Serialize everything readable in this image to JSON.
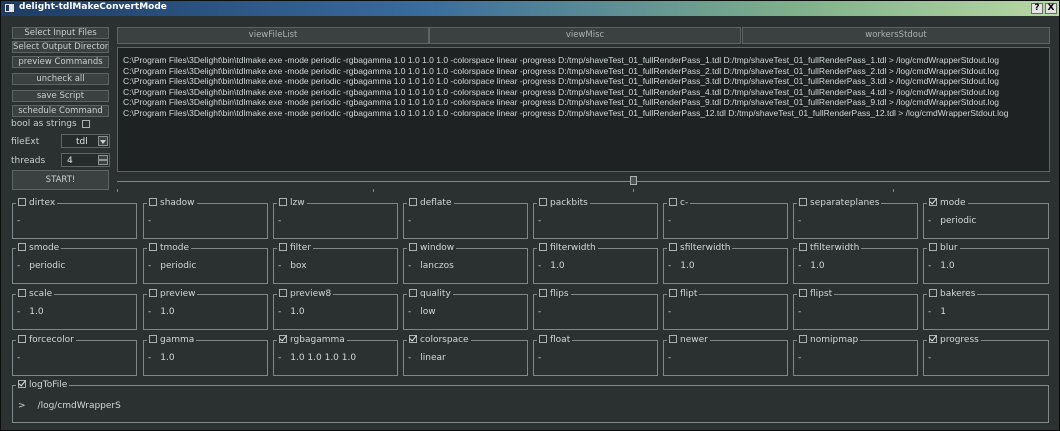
{
  "window": {
    "title": "delight-tdlMakeConvertMode",
    "help_glyph": "?",
    "close_glyph": "X"
  },
  "left_panel": {
    "buttons": [
      "Select Input Files",
      "Select Output Directory",
      "preview Commands",
      "uncheck all",
      "save Script",
      "schedule Command"
    ],
    "bool_as_strings_label": "bool as strings",
    "file_ext_label": "fileExt",
    "file_ext_value": "tdl",
    "threads_label": "threads",
    "threads_value": "4",
    "start_label": "START!"
  },
  "tabs": [
    "viewFileList",
    "viewMisc",
    "workersStdout"
  ],
  "log_lines": [
    "C:\\Program Files\\3Delight\\bin\\tdlmake.exe -mode periodic -rgbagamma 1.0 1.0 1.0 1.0 -colorspace linear -progress D:/tmp/shaveTest_01_fullRenderPass_1.tdl D:/tmp/shaveTest_01_fullRenderPass_1.tdl > /log/cmdWrapperStdout.log",
    "C:\\Program Files\\3Delight\\bin\\tdlmake.exe -mode periodic -rgbagamma 1.0 1.0 1.0 1.0 -colorspace linear -progress D:/tmp/shaveTest_01_fullRenderPass_2.tdl D:/tmp/shaveTest_01_fullRenderPass_2.tdl > /log/cmdWrapperStdout.log",
    "C:\\Program Files\\3Delight\\bin\\tdlmake.exe -mode periodic -rgbagamma 1.0 1.0 1.0 1.0 -colorspace linear -progress D:/tmp/shaveTest_01_fullRenderPass_3.tdl D:/tmp/shaveTest_01_fullRenderPass_3.tdl > /log/cmdWrapperStdout.log",
    "C:\\Program Files\\3Delight\\bin\\tdlmake.exe -mode periodic -rgbagamma 1.0 1.0 1.0 1.0 -colorspace linear -progress D:/tmp/shaveTest_01_fullRenderPass_4.tdl D:/tmp/shaveTest_01_fullRenderPass_4.tdl > /log/cmdWrapperStdout.log",
    "C:\\Program Files\\3Delight\\bin\\tdlmake.exe -mode periodic -rgbagamma 1.0 1.0 1.0 1.0 -colorspace linear -progress D:/tmp/shaveTest_01_fullRenderPass_9.tdl D:/tmp/shaveTest_01_fullRenderPass_9.tdl > /log/cmdWrapperStdout.log",
    "C:\\Program Files\\3Delight\\bin\\tdlmake.exe -mode periodic -rgbagamma 1.0 1.0 1.0 1.0 -colorspace linear -progress D:/tmp/shaveTest_01_fullRenderPass_12.tdl D:/tmp/shaveTest_01_fullRenderPass_12.tdl > /log/cmdWrapperStdout.log"
  ],
  "options": [
    {
      "name": "dirtex",
      "checked": false,
      "prefix": "-",
      "value": ""
    },
    {
      "name": "shadow",
      "checked": false,
      "prefix": "-",
      "value": ""
    },
    {
      "name": "lzw",
      "checked": false,
      "prefix": "-",
      "value": ""
    },
    {
      "name": "deflate",
      "checked": false,
      "prefix": "-",
      "value": ""
    },
    {
      "name": "packbits",
      "checked": false,
      "prefix": "-",
      "value": ""
    },
    {
      "name": "c-",
      "checked": false,
      "prefix": "-",
      "value": ""
    },
    {
      "name": "separateplanes",
      "checked": false,
      "prefix": "-",
      "value": ""
    },
    {
      "name": "mode",
      "checked": true,
      "prefix": "-",
      "value": "periodic"
    },
    {
      "name": "smode",
      "checked": false,
      "prefix": "-",
      "value": "periodic"
    },
    {
      "name": "tmode",
      "checked": false,
      "prefix": "-",
      "value": "periodic"
    },
    {
      "name": "filter",
      "checked": false,
      "prefix": "-",
      "value": "box"
    },
    {
      "name": "window",
      "checked": false,
      "prefix": "-",
      "value": "lanczos"
    },
    {
      "name": "filterwidth",
      "checked": false,
      "prefix": "-",
      "value": "1.0"
    },
    {
      "name": "sfilterwidth",
      "checked": false,
      "prefix": "-",
      "value": "1.0"
    },
    {
      "name": "tfilterwidth",
      "checked": false,
      "prefix": "-",
      "value": "1.0"
    },
    {
      "name": "blur",
      "checked": false,
      "prefix": "-",
      "value": "1.0"
    },
    {
      "name": "scale",
      "checked": false,
      "prefix": "-",
      "value": "1.0"
    },
    {
      "name": "preview",
      "checked": false,
      "prefix": "-",
      "value": "1.0"
    },
    {
      "name": "preview8",
      "checked": false,
      "prefix": "-",
      "value": "1.0"
    },
    {
      "name": "quality",
      "checked": false,
      "prefix": "-",
      "value": "low"
    },
    {
      "name": "flips",
      "checked": false,
      "prefix": "-",
      "value": ""
    },
    {
      "name": "flipt",
      "checked": false,
      "prefix": "-",
      "value": ""
    },
    {
      "name": "flipst",
      "checked": false,
      "prefix": "-",
      "value": ""
    },
    {
      "name": "bakeres",
      "checked": false,
      "prefix": "-",
      "value": "1"
    },
    {
      "name": "forcecolor",
      "checked": false,
      "prefix": "-",
      "value": ""
    },
    {
      "name": "gamma",
      "checked": false,
      "prefix": "-",
      "value": "1.0"
    },
    {
      "name": "rgbagamma",
      "checked": true,
      "prefix": "-",
      "value": "1.0 1.0 1.0 1.0"
    },
    {
      "name": "colorspace",
      "checked": true,
      "prefix": "-",
      "value": "linear"
    },
    {
      "name": "float",
      "checked": false,
      "prefix": "-",
      "value": ""
    },
    {
      "name": "newer",
      "checked": false,
      "prefix": "-",
      "value": ""
    },
    {
      "name": "nomipmap",
      "checked": false,
      "prefix": "-",
      "value": ""
    },
    {
      "name": "progress",
      "checked": true,
      "prefix": "-",
      "value": ""
    }
  ],
  "log_to_file": {
    "name": "logToFile",
    "checked": true,
    "prefix": ">",
    "value": "/log/cmdWrapperS"
  }
}
